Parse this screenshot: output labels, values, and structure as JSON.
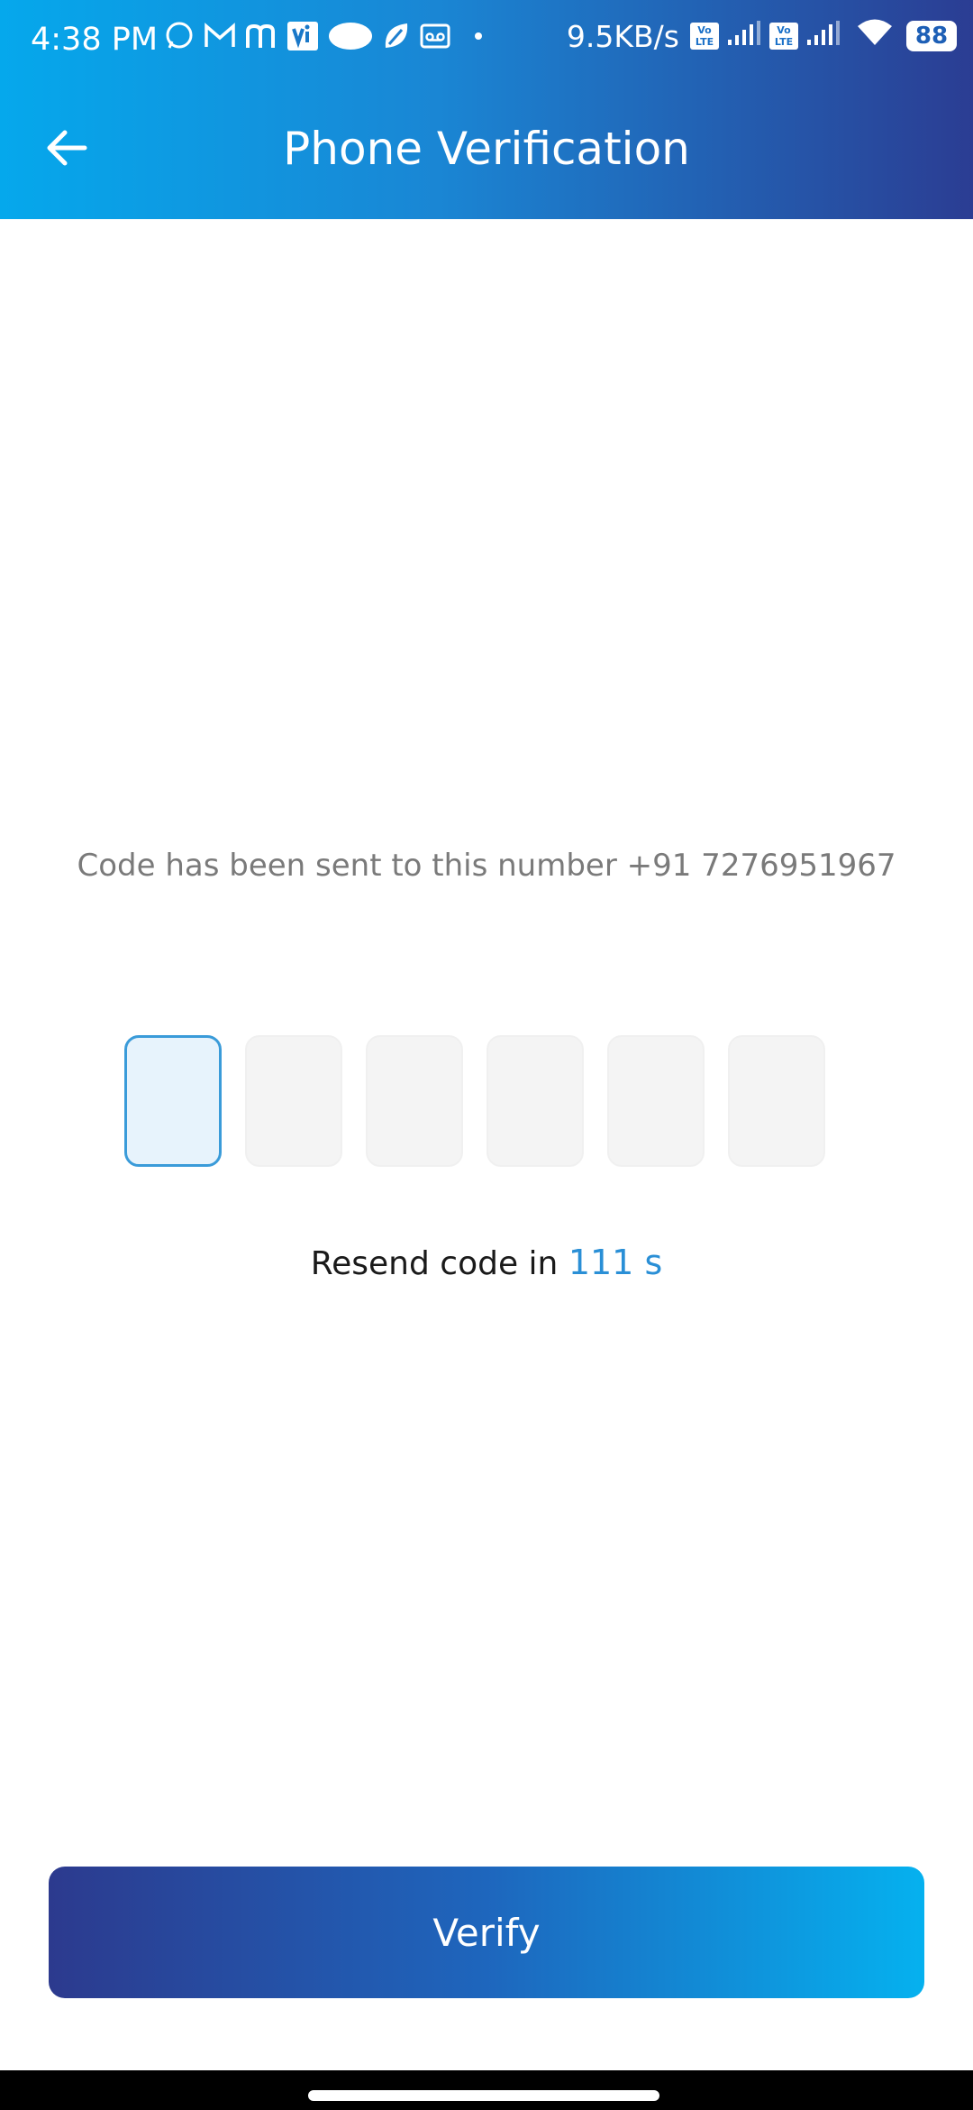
{
  "status_bar": {
    "time": "4:38 PM",
    "network_speed": "9.5KB/s",
    "volte1": "Vo LTE",
    "volte2": "Vo LTE",
    "battery": "88",
    "notification_icons": [
      "whatsapp-icon",
      "gmail-icon",
      "m-app-icon",
      "vi-icon",
      "cloud-icon",
      "leaf-icon",
      "voicemail-icon",
      "dot-icon"
    ]
  },
  "header": {
    "title": "Phone Verification",
    "back_icon": "arrow-left-icon"
  },
  "verification": {
    "sent_message": "Code has been sent to this number +91 7276951967",
    "otp_length": 6,
    "resend_label": "Resend code in",
    "countdown": "111 s"
  },
  "actions": {
    "verify_label": "Verify"
  },
  "colors": {
    "header_gradient_start": "#05a8ec",
    "header_gradient_end": "#2b3d93",
    "accent": "#2a8fd6",
    "button_gradient_start": "#2c3a8e",
    "button_gradient_end": "#05b1ef"
  }
}
